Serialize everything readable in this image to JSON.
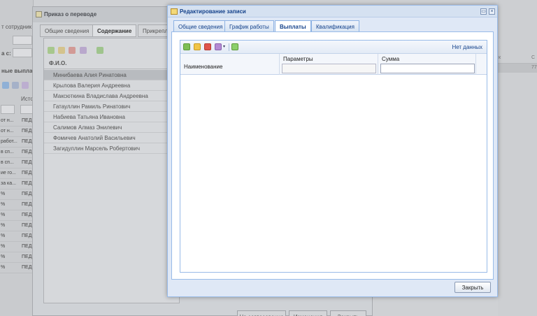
{
  "background": {
    "left_panel": {
      "label_employees": "т сотрудник",
      "label_date": "а с:",
      "section_title": "ные выплат",
      "column_header": "Исто",
      "rows": [
        {
          "c1": "от н...",
          "c2": "ПЕД"
        },
        {
          "c1": "от н...",
          "c2": "ПЕД"
        },
        {
          "c1": "работ...",
          "c2": "ПЕД"
        },
        {
          "c1": "в сп...",
          "c2": "ПЕД"
        },
        {
          "c1": "в сп...",
          "c2": "ПЕД"
        },
        {
          "c1": "ие го...",
          "c2": "ПЕД"
        },
        {
          "c1": "за ка...",
          "c2": "ПЕД"
        },
        {
          "c1": "%",
          "c2": "ПЕД"
        },
        {
          "c1": "%",
          "c2": "ПЕД"
        },
        {
          "c1": "%",
          "c2": "ПЕД"
        },
        {
          "c1": "%",
          "c2": "ПЕД"
        },
        {
          "c1": "%",
          "c2": "ПЕД"
        },
        {
          "c1": "%",
          "c2": "ПЕД"
        },
        {
          "c1": "%",
          "c2": "ПЕД"
        },
        {
          "c1": "%",
          "c2": "ПЕД"
        }
      ]
    },
    "right_panel": {
      "col1": "к",
      "col2": "С",
      "selected_value": "77"
    },
    "dialog": {
      "title": "Приказ о переводе",
      "tabs": [
        "Общие сведения",
        "Содержание",
        "Прикрепл"
      ],
      "active_tab_index": 1,
      "grid_header": "Ф.И.О.",
      "people": [
        "Минибаева Алия Ринатовна",
        "Крылова Валерия Андреевна",
        "Максюткина Владислава Андреевна",
        "Гатауллин Рамиль Ринатович",
        "Набиева Татьяна Ивановна",
        "Салимов Алмаз Энилевич",
        "Фомичев Анатолий Васильевич",
        "Загидуллин Марсель Робертович"
      ],
      "bottom_buttons": [
        "На согласование",
        "Изменения",
        "Закрыть"
      ]
    }
  },
  "dialog": {
    "title": "Редактирование записи",
    "tabs": [
      {
        "label": "Общие сведения"
      },
      {
        "label": "График работы"
      },
      {
        "label": "Выплаты"
      },
      {
        "label": "Квалификация"
      }
    ],
    "active_tab_index": 2,
    "toolbar": {
      "no_data_text": "Нет данных"
    },
    "grid": {
      "columns": [
        "Наименование",
        "Параметры",
        "Сумма"
      ],
      "rows": []
    },
    "close_button": "Закрыть"
  },
  "colors": {
    "accent": "#15428b",
    "border": "#99bbe8",
    "panel_bg": "#dfe8f6"
  }
}
